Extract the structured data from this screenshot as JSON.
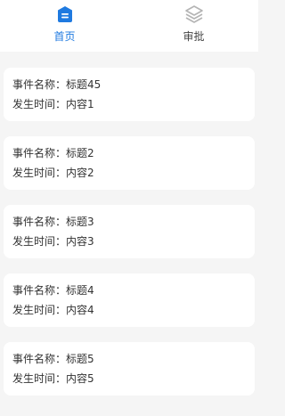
{
  "tabs": [
    {
      "label": "首页",
      "icon": "home-icon",
      "active": true,
      "color": "#1f7ae0"
    },
    {
      "label": "审批",
      "icon": "layers-icon",
      "active": false,
      "color": "#b4b4b4"
    }
  ],
  "items": [
    {
      "name_label": "事件名称：",
      "name_value": "标题45",
      "time_label": "发生时间：",
      "time_value": "内容1"
    },
    {
      "name_label": "事件名称：",
      "name_value": "标题2",
      "time_label": "发生时间：",
      "time_value": "内容2"
    },
    {
      "name_label": "事件名称：",
      "name_value": "标题3",
      "time_label": "发生时间：",
      "time_value": "内容3"
    },
    {
      "name_label": "事件名称：",
      "name_value": "标题4",
      "time_label": "发生时间：",
      "time_value": "内容4"
    },
    {
      "name_label": "事件名称：",
      "name_value": "标题5",
      "time_label": "发生时间：",
      "time_value": "内容5"
    }
  ]
}
